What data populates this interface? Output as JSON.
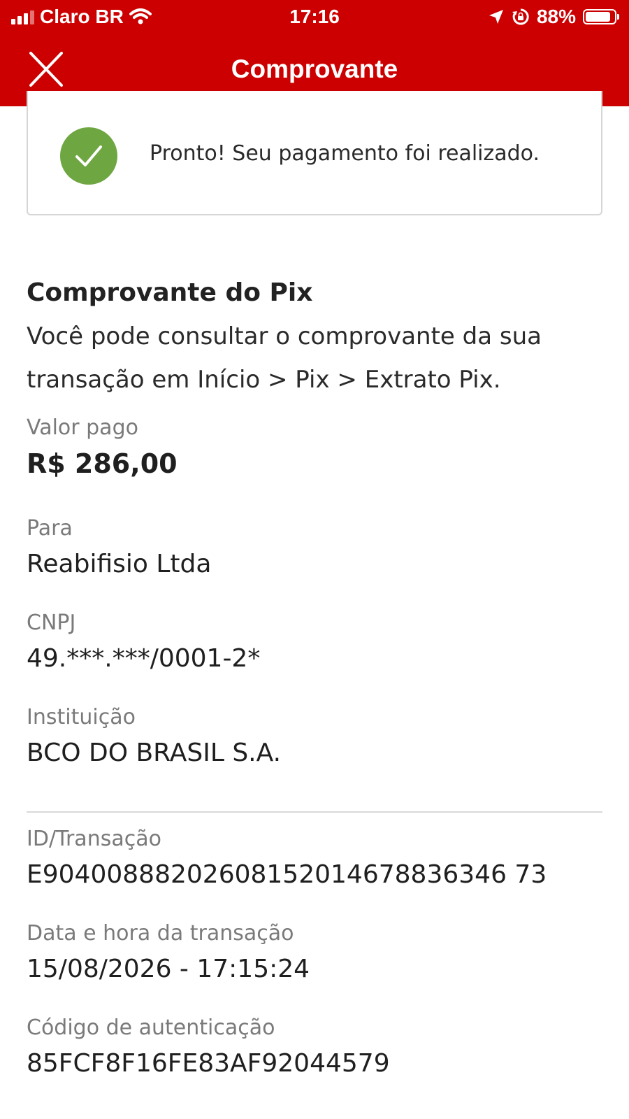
{
  "status_bar": {
    "carrier": "Claro BR",
    "time": "17:16",
    "battery": "88%"
  },
  "header": {
    "title": "Comprovante"
  },
  "success": {
    "message": "Pronto! Seu pagamento foi realizado."
  },
  "receipt": {
    "title": "Comprovante do Pix",
    "description": "Você pode consultar o comprovante da sua transação em Início > Pix > Extrato Pix."
  },
  "fields": {
    "valor_pago": {
      "label": "Valor pago",
      "value": "R$ 286,00"
    },
    "para": {
      "label": "Para",
      "value": "Reabifisio Ltda"
    },
    "cnpj": {
      "label": "CNPJ",
      "value": "49.***.***/0001-2*"
    },
    "instituicao": {
      "label": "Instituição",
      "value": "BCO DO BRASIL S.A."
    },
    "id_transacao": {
      "label": "ID/Transação",
      "value": "E90400888202608152014678836346 73"
    },
    "data_hora": {
      "label": "Data e hora da transação",
      "value": "15/08/2026 - 17:15:24"
    },
    "codigo_autenticacao": {
      "label": "Código de autenticação",
      "value": "85FCF8F16FE83AF92044579"
    }
  },
  "icons": {
    "close": "close-icon",
    "success": "checkmark-circle-icon",
    "wifi": "wifi-icon",
    "location": "location-arrow-icon",
    "rotation_lock": "rotation-lock-icon",
    "battery": "battery-icon",
    "signal": "signal-icon"
  },
  "colors": {
    "brand_red": "#cc0000",
    "success_green": "#6ea641"
  }
}
